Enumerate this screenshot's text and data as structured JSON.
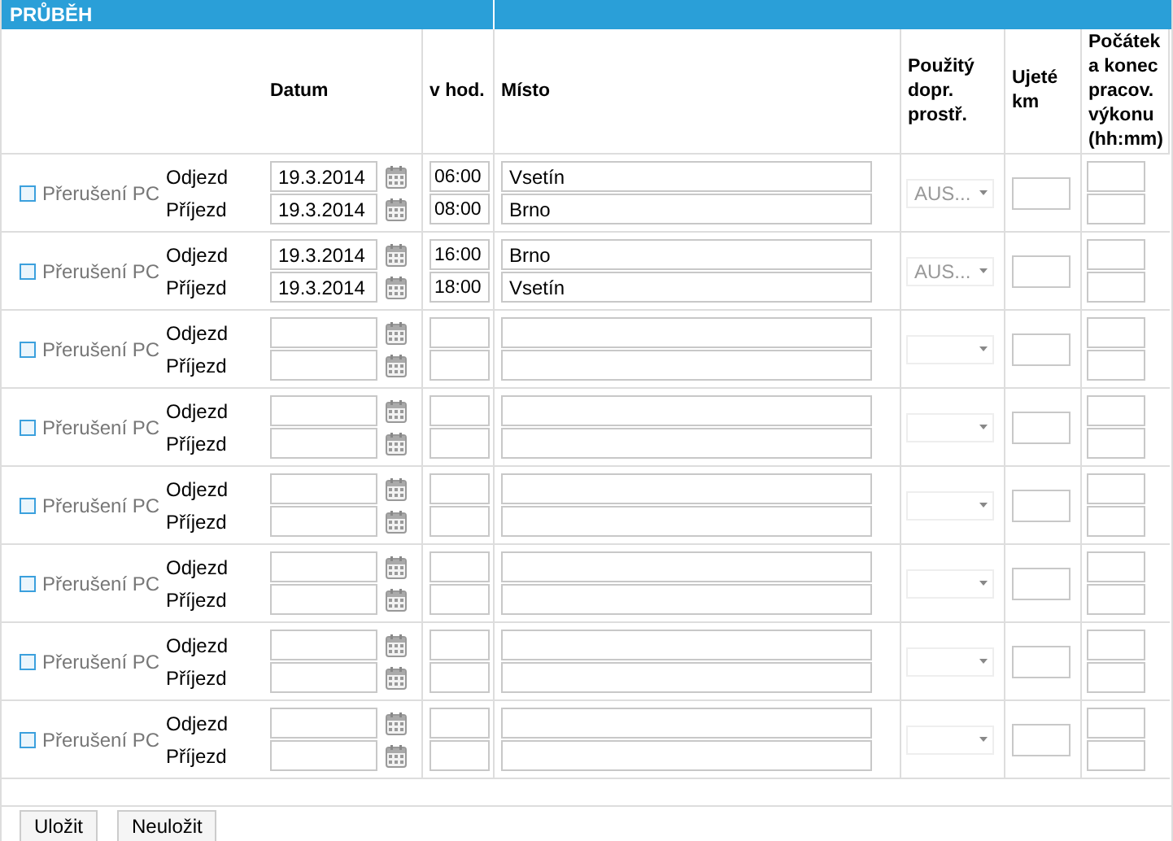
{
  "section": {
    "title": "PRŮBĚH"
  },
  "columns": [
    {
      "label": "Datum"
    },
    {
      "label": "v hod."
    },
    {
      "label": "Místo"
    },
    {
      "label": "Použitý dopr. prostř."
    },
    {
      "label": "Ujeté km"
    },
    {
      "label": "Počátek a konec pracov. výkonu (hh:mm)"
    }
  ],
  "rows": [
    {
      "interruption": {
        "label": "Přerušení PC",
        "checked": false
      },
      "legs": [
        {
          "label": "Odjezd",
          "date": "19.3.2014",
          "time": "06:00",
          "place": "Vsetín"
        },
        {
          "label": "Příjezd",
          "date": "19.3.2014",
          "time": "08:00",
          "place": "Brno"
        }
      ],
      "transport": "AUS..."
    },
    {
      "interruption": {
        "label": "Přerušení PC",
        "checked": false
      },
      "legs": [
        {
          "label": "Odjezd",
          "date": "19.3.2014",
          "time": "16:00",
          "place": "Brno"
        },
        {
          "label": "Příjezd",
          "date": "19.3.2014",
          "time": "18:00",
          "place": "Vsetín"
        }
      ],
      "transport": "AUS..."
    },
    {
      "interruption": {
        "label": "Přerušení PC",
        "checked": false
      },
      "legs": [
        {
          "label": "Odjezd"
        },
        {
          "label": "Příjezd"
        }
      ]
    },
    {
      "interruption": {
        "label": "Přerušení PC",
        "checked": false
      },
      "legs": [
        {
          "label": "Odjezd"
        },
        {
          "label": "Příjezd"
        }
      ]
    },
    {
      "interruption": {
        "label": "Přerušení PC",
        "checked": false
      },
      "legs": [
        {
          "label": "Odjezd"
        },
        {
          "label": "Příjezd"
        }
      ]
    },
    {
      "interruption": {
        "label": "Přerušení PC",
        "checked": false
      },
      "legs": [
        {
          "label": "Odjezd"
        },
        {
          "label": "Příjezd"
        }
      ]
    },
    {
      "interruption": {
        "label": "Přerušení PC",
        "checked": false
      },
      "legs": [
        {
          "label": "Odjezd"
        },
        {
          "label": "Příjezd"
        }
      ]
    },
    {
      "interruption": {
        "label": "Přerušení PC",
        "checked": false
      },
      "legs": [
        {
          "label": "Odjezd"
        },
        {
          "label": "Příjezd"
        }
      ]
    }
  ],
  "buttons": [
    "Uložit",
    "Neuložit"
  ]
}
